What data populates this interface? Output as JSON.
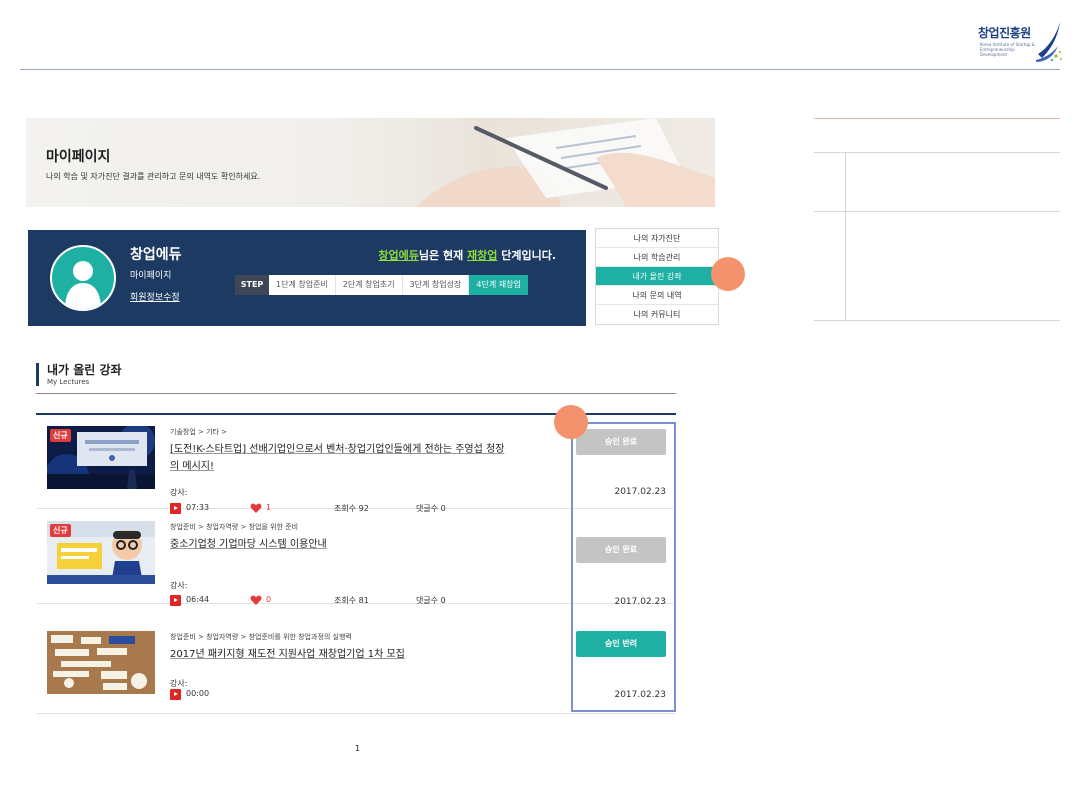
{
  "header": {
    "logo_name": "창업진흥원",
    "logo_sub": "Korea Institute of Startup & Entrepreneurship Development"
  },
  "hero": {
    "title": "마이페이지",
    "description": "나의 학습 및 자가진단 결과를 관리하고 문의 내역도 확인하세요."
  },
  "profile": {
    "name": "창업에듀",
    "link_mypage": "마이페이지",
    "link_edit": "회원정보수정",
    "status_user": "창업에듀",
    "status_mid": "님은 현재 ",
    "status_stage": "재창업",
    "status_tail": " 단계입니다.",
    "step_label": "STEP",
    "steps": [
      "1단계 창업준비",
      "2단계 창업초기",
      "3단계 창업성장",
      "4단계 재창업"
    ]
  },
  "menu": {
    "items": [
      "나의 자가진단",
      "나의 학습관리",
      "내가 올린 강좌",
      "나의 문의 내역",
      "나의 커뮤니티"
    ]
  },
  "section": {
    "title": "내가 올린 강좌",
    "subtitle": "My Lectures"
  },
  "lectures": [
    {
      "badge": "신규",
      "breadcrumb": "기술창업 > 기타 >",
      "title": "[도전!K-스타트업] 선배기업인으로서 벤처·창업기업인들에게 전하는 주영섭 청장의 메시지!",
      "teacher": "강사:",
      "duration": "07:33",
      "likes": "1",
      "views": "조회수 92",
      "comments": "댓글수 0",
      "status": "승인 완료",
      "date": "2017.02.23"
    },
    {
      "badge": "신규",
      "breadcrumb": "창업준비 > 창업자역량 > 창업을 위한 준비",
      "title": "중소기업청 기업마당 시스템 이용안내",
      "teacher": "강사:",
      "duration": "06:44",
      "likes": "0",
      "views": "조회수 81",
      "comments": "댓글수 0",
      "status": "승인 완료",
      "date": "2017.02.23"
    },
    {
      "breadcrumb": "창업준비 > 창업자역량 > 창업준비를 위한 창업과정의 실행력",
      "title": "2017년 패키지형 재도전 지원사업 재창업기업 1차 모집",
      "teacher": "강사:",
      "duration": "00:00",
      "status": "승인 반려",
      "date": "2017.02.23"
    }
  ],
  "pagination": {
    "current": "1"
  },
  "colors": {
    "navy": "#1d3a63",
    "teal": "#1fb0a4",
    "marker": "#f5926e",
    "highlight": "#7b8fd6"
  }
}
